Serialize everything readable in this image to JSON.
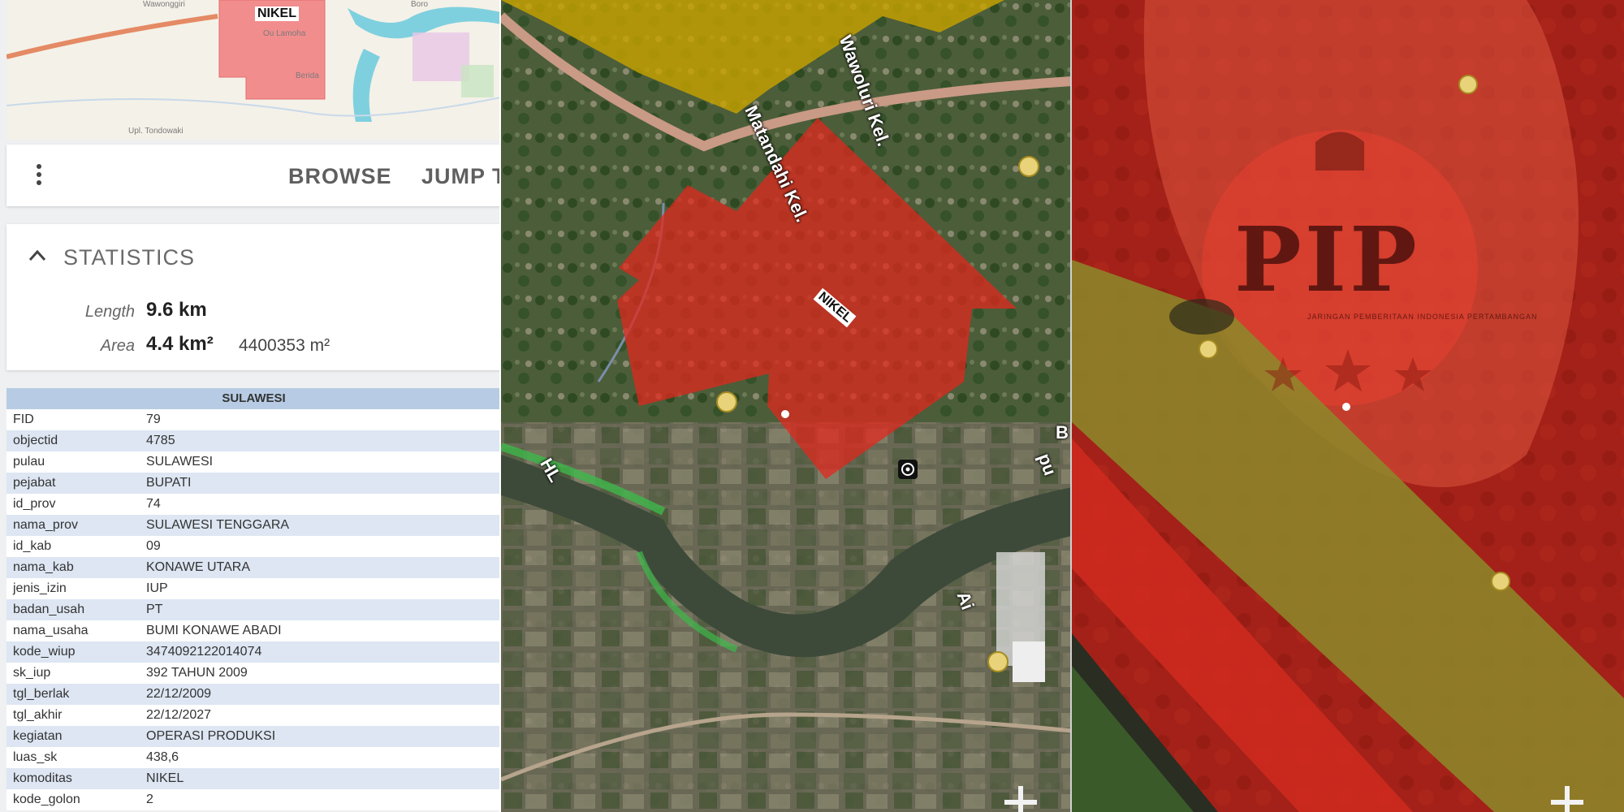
{
  "minimap": {
    "polygon_label": "NIKEL",
    "place_labels": [
      "Wawonggiri",
      "Ou Lamoha",
      "Berida",
      "Upl. Tondowaki",
      "Boro"
    ]
  },
  "toolbar": {
    "menu_icon": "more-vert-icon",
    "browse_label": "BROWSE",
    "jump_label": "JUMP T"
  },
  "statistics": {
    "title": "STATISTICS",
    "chevron_icon": "chevron-up-icon",
    "length_label": "Length",
    "length_value": "9.6 km",
    "area_label": "Area",
    "area_value": "4.4 km²",
    "area_m2": "4400353 m²"
  },
  "attributes": {
    "header": "SULAWESI",
    "rows": [
      {
        "key": "FID",
        "value": "79"
      },
      {
        "key": "objectid",
        "value": "4785"
      },
      {
        "key": "pulau",
        "value": "SULAWESI"
      },
      {
        "key": "pejabat",
        "value": "BUPATI"
      },
      {
        "key": "id_prov",
        "value": "74"
      },
      {
        "key": "nama_prov",
        "value": "SULAWESI TENGGARA"
      },
      {
        "key": "id_kab",
        "value": "09"
      },
      {
        "key": "nama_kab",
        "value": "KONAWE UTARA"
      },
      {
        "key": "jenis_izin",
        "value": "IUP"
      },
      {
        "key": "badan_usah",
        "value": "PT"
      },
      {
        "key": "nama_usaha",
        "value": "BUMI KONAWE ABADI"
      },
      {
        "key": "kode_wiup",
        "value": "3474092122014074"
      },
      {
        "key": "sk_iup",
        "value": "392 TAHUN 2009"
      },
      {
        "key": "tgl_berlak",
        "value": "22/12/2009"
      },
      {
        "key": "tgl_akhir",
        "value": "22/12/2027"
      },
      {
        "key": "kegiatan",
        "value": "OPERASI PRODUKSI"
      },
      {
        "key": "luas_sk",
        "value": "438,6"
      },
      {
        "key": "komoditas",
        "value": "NIKEL"
      },
      {
        "key": "kode_golon",
        "value": "2"
      }
    ]
  },
  "satellite": {
    "polygon_label": "NIKEL",
    "street_labels": [
      "Wawoluri Kel.",
      "Matandahi Kel.",
      "HL",
      "B",
      "pu",
      "Ai"
    ],
    "zoom_in_icon": "plus-icon",
    "target_icon": "target-icon",
    "colors": {
      "red_zone": "#e0281e",
      "yellow_zone": "#c9a400",
      "green_zone": "#6fbf3a"
    }
  },
  "zoomed": {
    "watermark": "PIP",
    "watermark_sub": "JARINGAN PEMBERITAAN INDONESIA PERTAMBANGAN",
    "zoom_in_icon": "plus-icon"
  }
}
